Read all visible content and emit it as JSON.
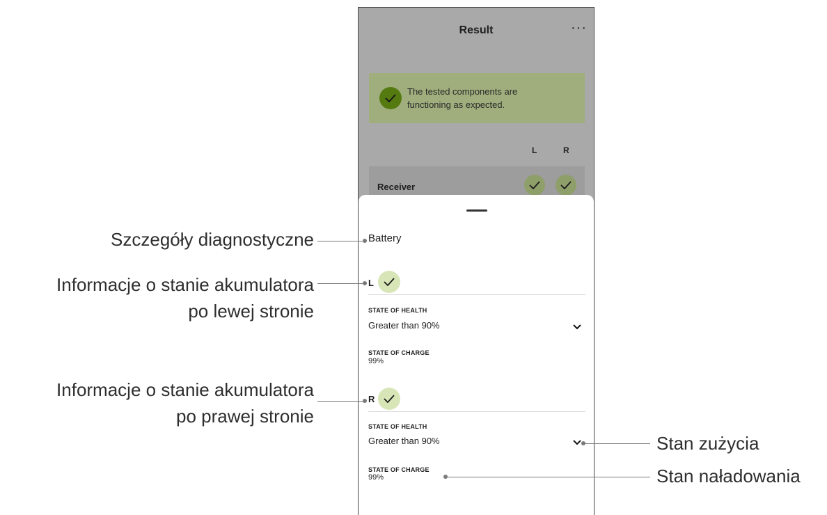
{
  "app": {
    "title": "Result",
    "more_label": "···"
  },
  "summary": {
    "message": "The tested components are functioning as expected."
  },
  "columns": {
    "left": "L",
    "right": "R"
  },
  "components": [
    {
      "label": "Receiver"
    }
  ],
  "sheet": {
    "heading": "Battery",
    "left": {
      "label": "L",
      "health_caption": "STATE OF HEALTH",
      "health_value": "Greater than 90%",
      "charge_caption": "STATE OF CHARGE",
      "charge_value": "99%"
    },
    "right": {
      "label": "R",
      "health_caption": "STATE OF HEALTH",
      "health_value": "Greater than 90%",
      "charge_caption": "STATE OF CHARGE",
      "charge_value": "99%"
    }
  },
  "annotations": {
    "diagnostic_details": "Szczegóły diagnostyczne",
    "left_battery_line1": "Informacje o stanie akumulatora",
    "left_battery_line2": "po lewej stronie",
    "right_battery_line1": "Informacje o stanie akumulatora",
    "right_battery_line2": "po prawej stronie",
    "state_of_health": "Stan zużycia",
    "state_of_charge": "Stan naładowania"
  },
  "colors": {
    "success_bg": "#9fae7c",
    "success_icon": "#557a10",
    "check_bg": "#d8e6b7",
    "dim_overlay": "#a9a9a9"
  }
}
